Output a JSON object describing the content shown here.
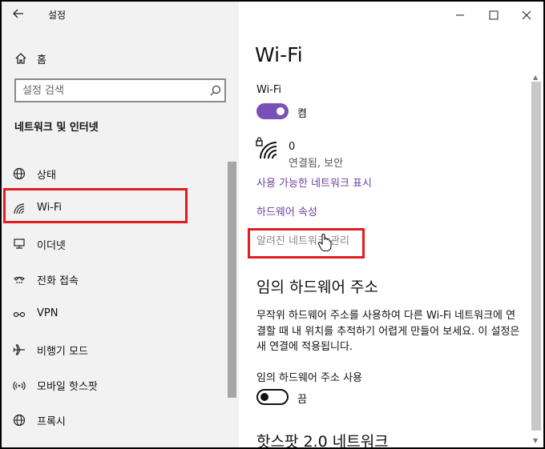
{
  "window": {
    "title": "설정"
  },
  "sidebar": {
    "home_label": "홈",
    "search_placeholder": "설정 검색",
    "section_title": "네트워크 및 인터넷",
    "items": [
      {
        "label": "상태",
        "icon": "globe-icon"
      },
      {
        "label": "Wi-Fi",
        "icon": "wifi-icon"
      },
      {
        "label": "이더넷",
        "icon": "ethernet-icon"
      },
      {
        "label": "전화 접속",
        "icon": "dialup-icon"
      },
      {
        "label": "VPN",
        "icon": "vpn-icon"
      },
      {
        "label": "비행기 모드",
        "icon": "airplane-icon"
      },
      {
        "label": "모바일 핫스팟",
        "icon": "hotspot-icon"
      },
      {
        "label": "프록시",
        "icon": "globe-icon"
      }
    ]
  },
  "main": {
    "page_title": "Wi-Fi",
    "wifi_toggle_label": "Wi-Fi",
    "wifi_state": "켬",
    "network": {
      "name": "0",
      "status": "연결됨, 보안"
    },
    "links": {
      "show_networks": "사용 가능한 네트워크 표시",
      "hardware_props": "하드웨어 속성",
      "manage_known": "알려진 네트워크 관리"
    },
    "random_hw": {
      "heading": "임의 하드웨어 주소",
      "description": "무작위 하드웨어 주소를 사용하여 다른 Wi-Fi 네트워크에 연결할 때 내 위치를 추적하기 어렵게 만들어 보세요. 이 설정은 새 연결에 적용됩니다.",
      "toggle_label": "임의 하드웨어 주소 사용",
      "toggle_state": "끔"
    },
    "hotspot_heading": "핫스팟 2.0 네트워크"
  },
  "colors": {
    "accent": "#7b4fb8",
    "link": "#6b3fa0",
    "highlight": "#e01e1e"
  }
}
